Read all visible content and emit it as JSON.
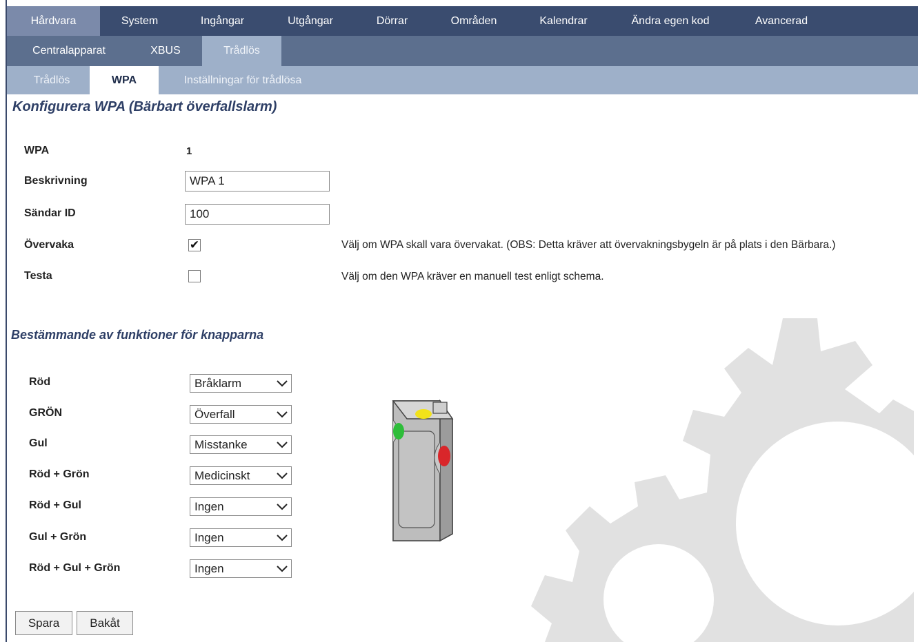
{
  "nav": {
    "main_tabs": [
      "Hårdvara",
      "System",
      "Ingångar",
      "Utgångar",
      "Dörrar",
      "Områden",
      "Kalendrar",
      "Ändra egen kod",
      "Avancerad"
    ],
    "main_active": 0,
    "sub_tabs": [
      "Centralapparat",
      "XBUS",
      "Trådlös"
    ],
    "sub_active": 2,
    "sub2_tabs": [
      "Trådlös",
      "WPA",
      "Inställningar för trådlösa"
    ],
    "sub2_active": 1
  },
  "form": {
    "title": "Konfigurera WPA (Bärbart överfallslarm)",
    "wpa_label": "WPA",
    "wpa_value": "1",
    "description_label": "Beskrivning",
    "description_value": "WPA 1",
    "sender_label": "Sändar ID",
    "sender_value": "100",
    "supervise_label": "Övervaka",
    "supervise_checked": true,
    "supervise_hint": "Välj om WPA skall vara övervakat. (OBS: Detta kräver att övervakningsbygeln är på plats i den Bärbara.)",
    "test_label": "Testa",
    "test_checked": false,
    "test_hint": "Välj om den WPA kräver en manuell test enligt schema."
  },
  "buttons_section": {
    "title": "Bestämmande av funktioner för knapparna",
    "rows": [
      {
        "label": "Röd",
        "value": "Bråklarm"
      },
      {
        "label": "GRÖN",
        "value": "Överfall"
      },
      {
        "label": "Gul",
        "value": "Misstanke"
      },
      {
        "label": "Röd + Grön",
        "value": "Medicinskt"
      },
      {
        "label": "Röd + Gul",
        "value": "Ingen"
      },
      {
        "label": "Gul + Grön",
        "value": "Ingen"
      },
      {
        "label": "Röd + Gul + Grön",
        "value": "Ingen"
      }
    ]
  },
  "actions": {
    "save": "Spara",
    "back": "Bakåt"
  },
  "colors": {
    "nav_main": "#3a4c6f",
    "nav_sub": "#5c6f8e",
    "nav_sub2": "#9eb0c9",
    "heading": "#2e3f66",
    "led_red": "#d9262a",
    "led_green": "#2ebd3a",
    "led_yellow": "#f2e21a"
  }
}
